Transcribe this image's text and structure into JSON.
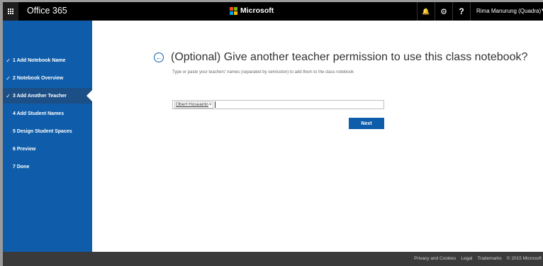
{
  "topbar": {
    "app_title": "Office 365",
    "brand": "Microsoft",
    "notifications_glyph": "🔔",
    "settings_glyph": "⚙",
    "help_glyph": "?",
    "user_name": "Rima Manurung (Quadra)",
    "user_caret": "▾",
    "icons": [
      "app-launcher-icon",
      "microsoft-logo-icon",
      "bell-icon",
      "gear-icon",
      "help-icon"
    ]
  },
  "sidebar": {
    "steps": [
      {
        "check": "✓",
        "label": "1  Add Notebook Name"
      },
      {
        "check": "✓",
        "label": "2  Notebook Overview"
      },
      {
        "check": "✓",
        "label": "3  Add Another Teacher"
      },
      {
        "check": "",
        "label": "4  Add Student Names"
      },
      {
        "check": "",
        "label": "5  Design Student Spaces"
      },
      {
        "check": "",
        "label": "6  Preview"
      },
      {
        "check": "",
        "label": "7  Done"
      }
    ],
    "active_step": 3
  },
  "main": {
    "back_glyph": "←",
    "heading": "(Optional) Give another teacher permission to use this class notebook?",
    "subtext": "Type or paste your teachers' names (separated by semicolon) to add them to the class notebook",
    "teacher_chip": "Obert Hoseanto",
    "chip_remove": "×",
    "next_label": "Next"
  },
  "footer": {
    "links": [
      "Privacy and Cookies",
      "Legal",
      "Trademarks",
      "© 2015 Microsoft"
    ]
  },
  "colors": {
    "topbar": "#000000",
    "sidebar": "#0f5daa",
    "sidebar_active": "#1b4f86",
    "accent": "#0f5daa",
    "footer": "#3a3a3a",
    "ms_logo": [
      "#f25022",
      "#7fba00",
      "#00a4ef",
      "#ffb900"
    ]
  }
}
